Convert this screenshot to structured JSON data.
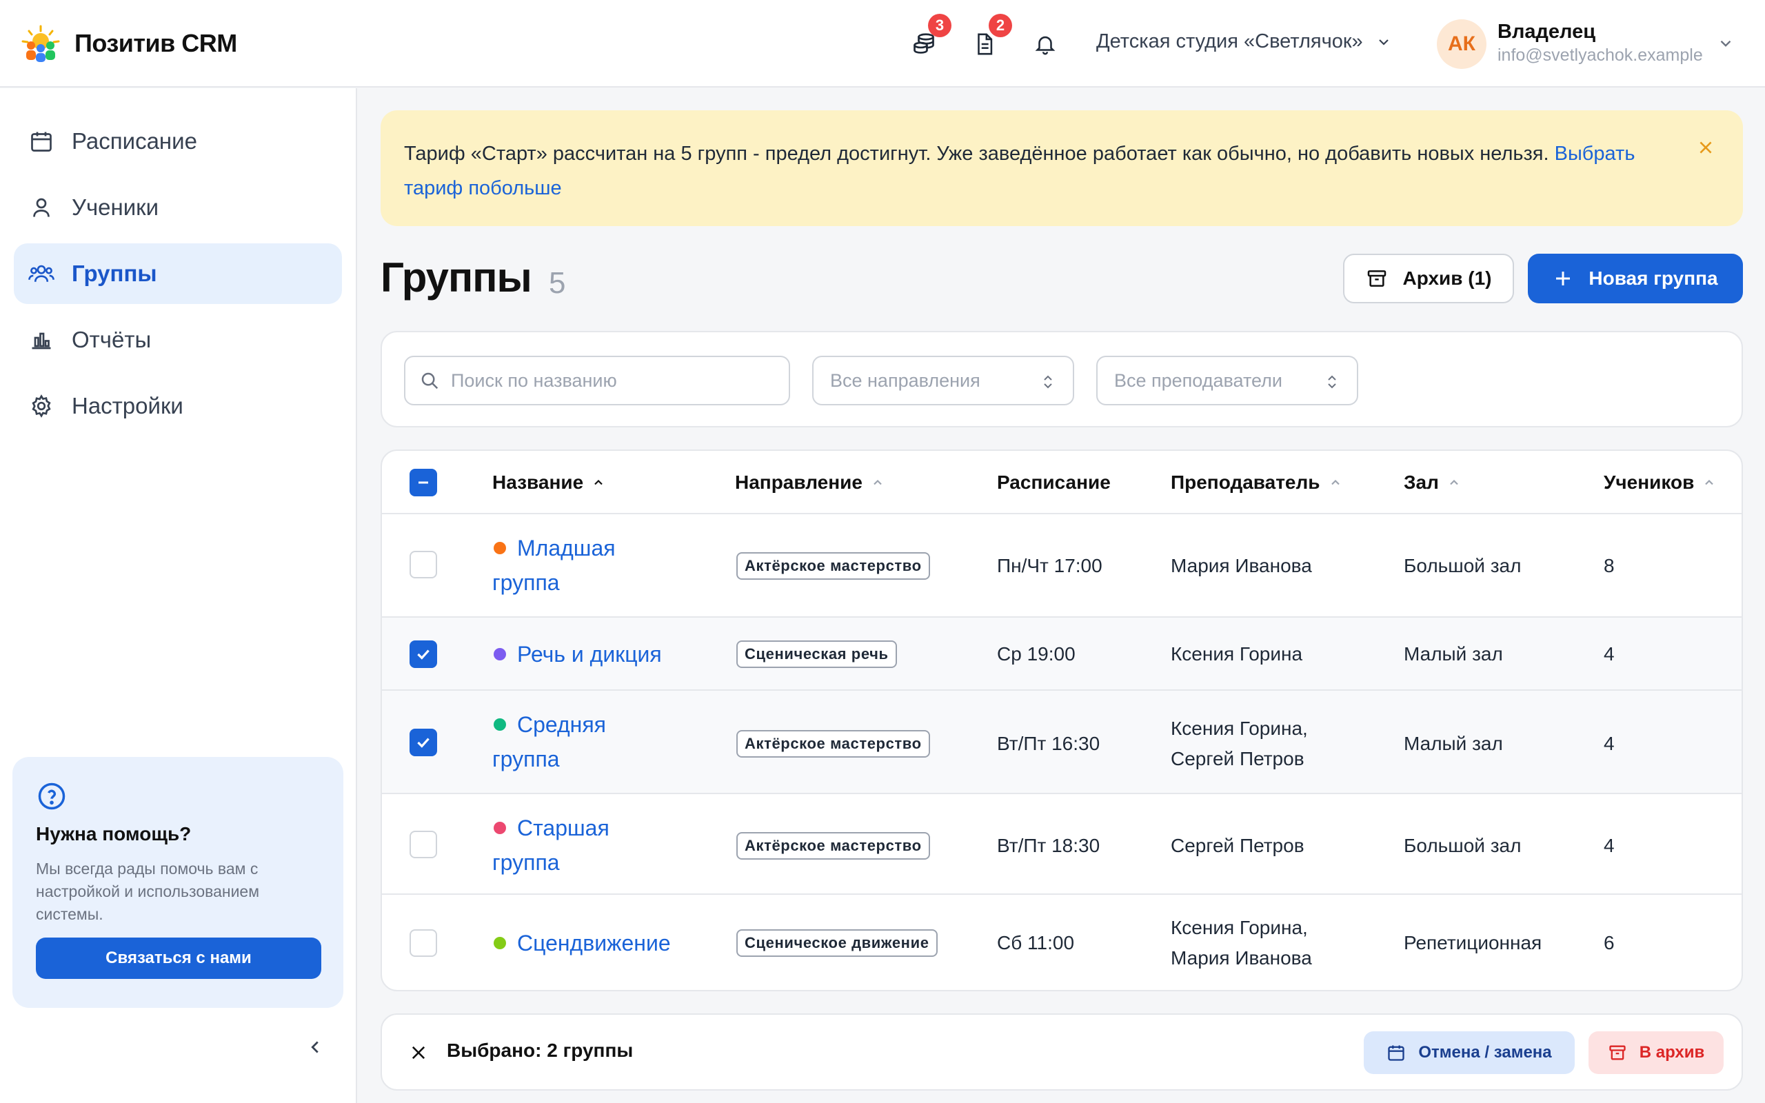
{
  "app": {
    "name": "Позитив CRM"
  },
  "header": {
    "notifications": [
      {
        "icon": "coins-icon",
        "count": "3"
      },
      {
        "icon": "document-icon",
        "count": "2"
      },
      {
        "icon": "bell-icon",
        "count": ""
      }
    ],
    "studio": "Детская студия «Светлячок»",
    "user": {
      "initials": "АК",
      "role": "Владелец",
      "email": "info@svetlyachok.example"
    }
  },
  "sidebar": {
    "items": [
      {
        "label": "Расписание",
        "icon": "calendar-icon"
      },
      {
        "label": "Ученики",
        "icon": "user-icon"
      },
      {
        "label": "Группы",
        "icon": "users-icon",
        "active": true
      },
      {
        "label": "Отчёты",
        "icon": "chart-icon"
      },
      {
        "label": "Настройки",
        "icon": "gear-icon"
      }
    ],
    "help": {
      "title": "Нужна помощь?",
      "text": "Мы всегда рады помочь вам с настройкой и использованием системы.",
      "button": "Связаться с нами"
    }
  },
  "banner": {
    "text": "Тариф «Старт» рассчитан на 5 групп - предел достигнут. Уже заведённое работает как обычно, но добавить новых нельзя. ",
    "link": "Выбрать тариф побольше"
  },
  "page": {
    "title": "Группы",
    "count": "5",
    "archive_button": "Архив (1)",
    "new_button": "Новая группа"
  },
  "filters": {
    "search_placeholder": "Поиск по названию",
    "direction": "Все направления",
    "teacher": "Все преподаватели"
  },
  "table": {
    "columns": [
      "Название",
      "Направление",
      "Расписание",
      "Преподаватель",
      "Зал",
      "Учеников"
    ],
    "rows": [
      {
        "name": "Младшая группа",
        "color": "#f97316",
        "direction": "Актёрское мастерство",
        "schedule": "Пн/Чт 17:00",
        "teacher": "Мария Иванова",
        "hall": "Большой зал",
        "students": "8",
        "checked": false
      },
      {
        "name": "Речь и дикция",
        "color": "#7c5cf0",
        "direction": "Сценическая речь",
        "schedule": "Ср 19:00",
        "teacher": "Ксения Горина",
        "hall": "Малый зал",
        "students": "4",
        "checked": true
      },
      {
        "name": "Средняя группа",
        "color": "#10b981",
        "direction": "Актёрское мастерство",
        "schedule": "Вт/Пт 16:30",
        "teacher": "Ксения Горина, Сергей Петров",
        "hall": "Малый зал",
        "students": "4",
        "checked": true
      },
      {
        "name": "Старшая группа",
        "color": "#ec4870",
        "direction": "Актёрское мастерство",
        "schedule": "Вт/Пт 18:30",
        "teacher": "Сергей Петров",
        "hall": "Большой зал",
        "students": "4",
        "checked": false
      },
      {
        "name": "Сцендвижение",
        "color": "#84cc16",
        "direction": "Сценическое движение",
        "schedule": "Сб 11:00",
        "teacher": "Ксения Горина, Мария Иванова",
        "hall": "Репетиционная",
        "students": "6",
        "checked": false
      }
    ]
  },
  "bulk": {
    "text": "Выбрано: 2 группы",
    "cancel_button": "Отмена / замена",
    "archive_button": "В архив"
  },
  "colors": {
    "accent": "#1a63d8",
    "banner": "#fdf2c5",
    "danger": "#dc2626"
  }
}
